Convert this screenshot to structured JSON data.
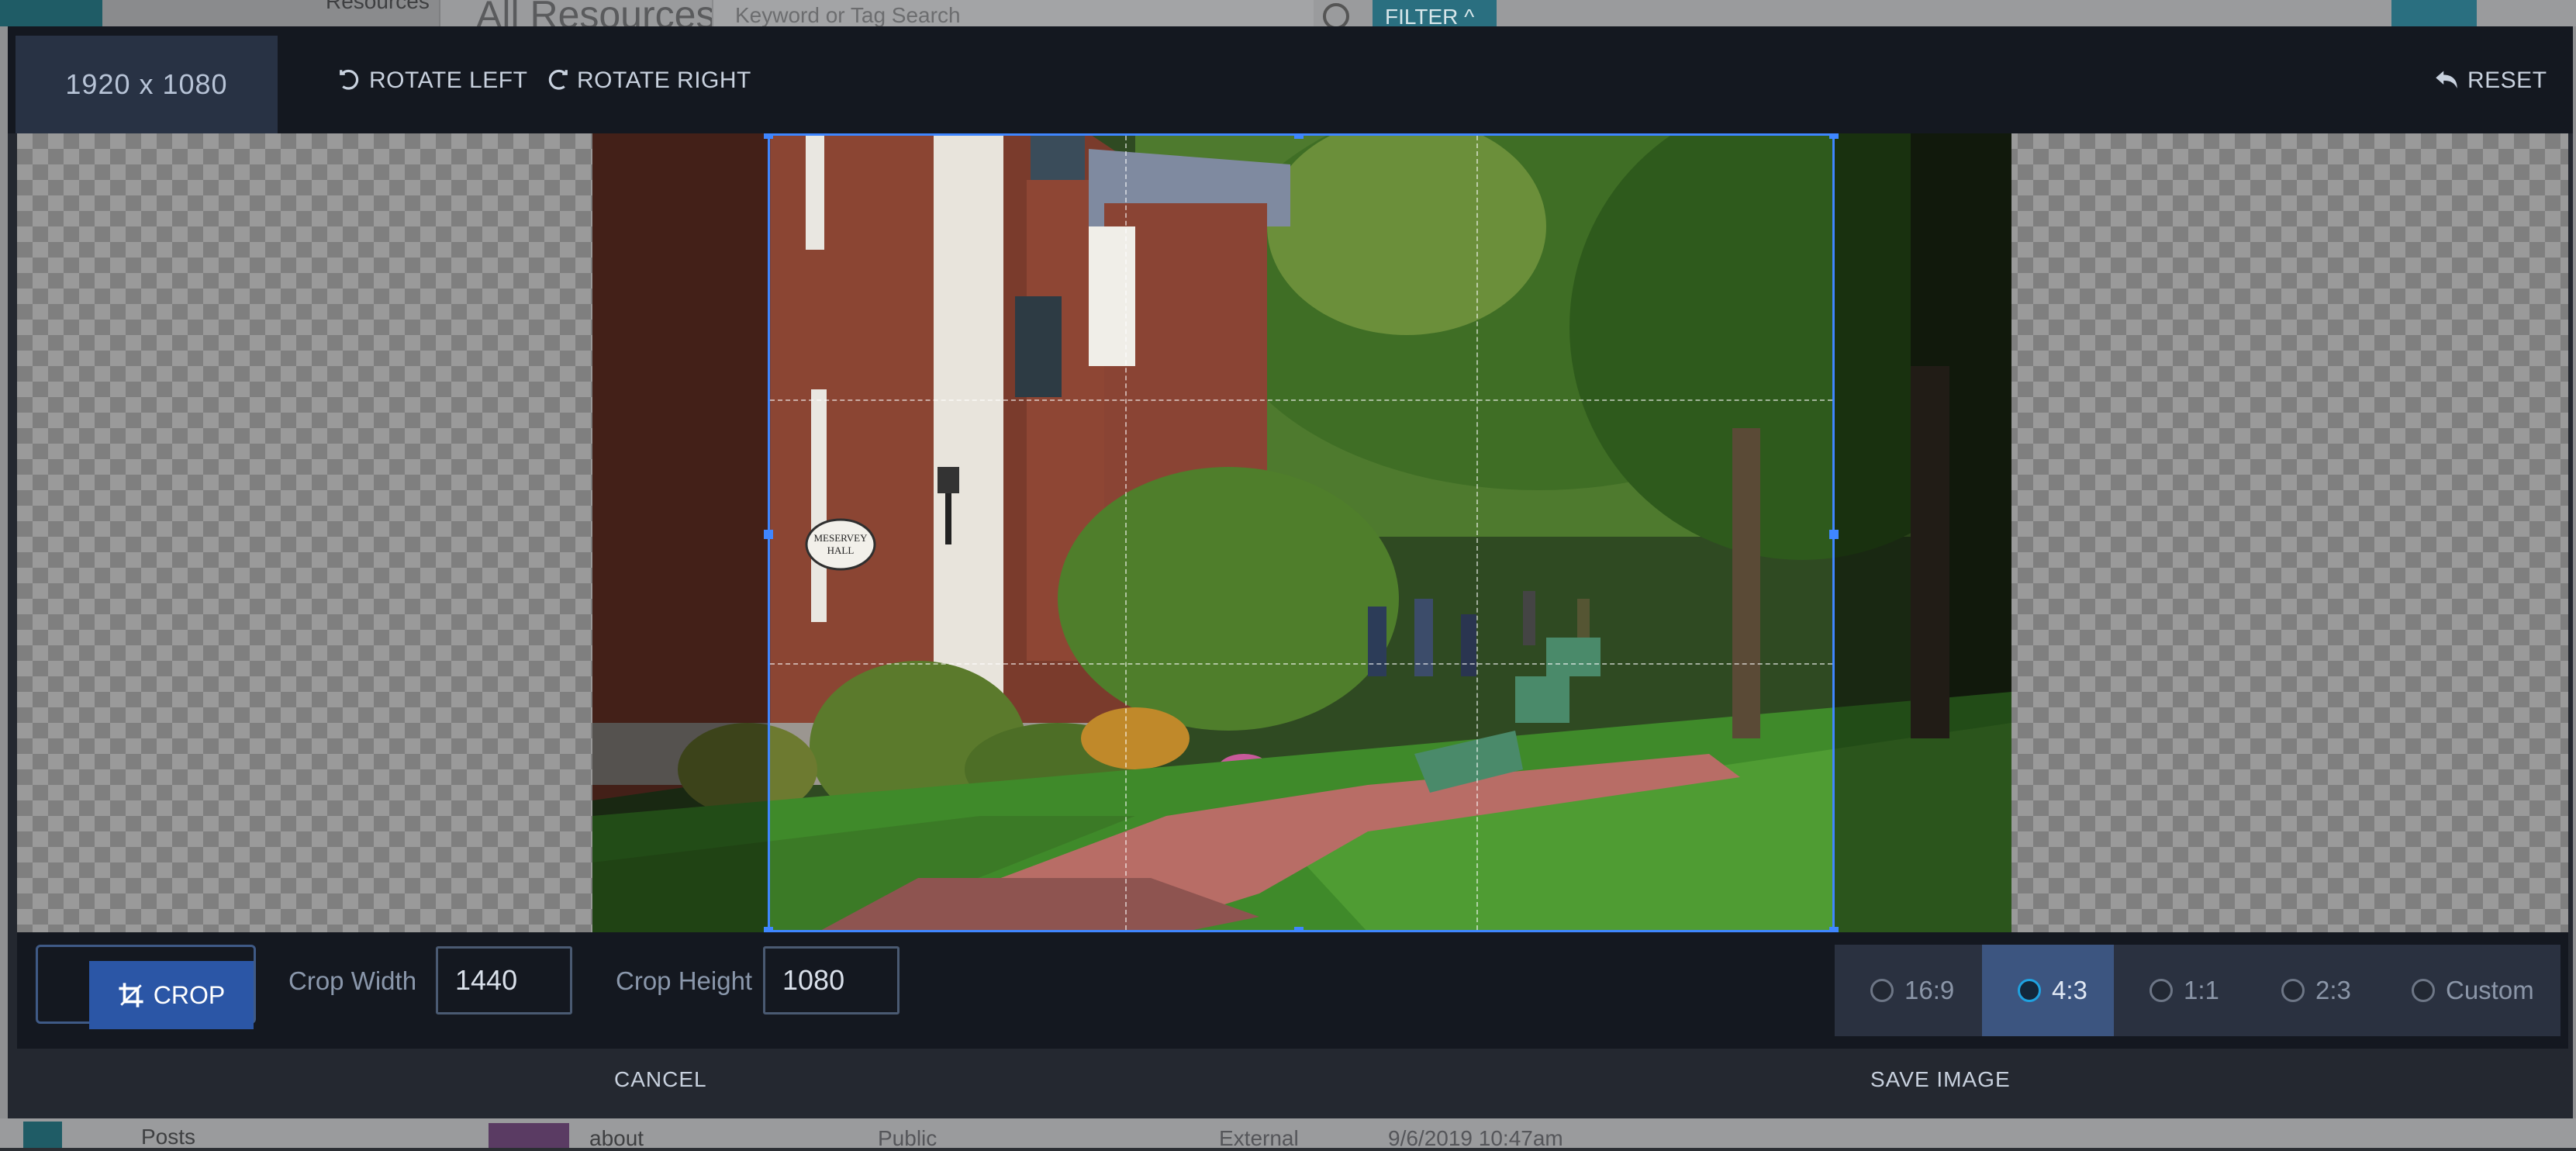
{
  "background": {
    "breadcrumb": "Resources",
    "page_title": "All Resources",
    "search_placeholder": "Keyword or Tag Search",
    "filter_label": "FILTER",
    "sidebar_item": "Posts",
    "row": {
      "name": "about",
      "visibility": "Public",
      "type": "External",
      "date": "9/6/2019 10:47am"
    }
  },
  "editor": {
    "dimensions": "1920 x 1080",
    "rotate_left": "ROTATE LEFT",
    "rotate_right": "ROTATE RIGHT",
    "reset": "RESET",
    "image": {
      "sign_line1": "MESERVEY",
      "sign_line2": "HALL"
    },
    "crop_button": "CROP",
    "crop_width_label": "Crop Width",
    "crop_width": "1440",
    "crop_height_label": "Crop Height",
    "crop_height": "1080",
    "ratios": [
      {
        "label": "16:9",
        "selected": false
      },
      {
        "label": "4:3",
        "selected": true
      },
      {
        "label": "1:1",
        "selected": false
      },
      {
        "label": "2:3",
        "selected": false
      },
      {
        "label": "Custom",
        "selected": false
      }
    ],
    "cancel": "CANCEL",
    "save": "SAVE IMAGE"
  },
  "colors": {
    "accent": "#3f86ff",
    "crop_button": "#2b56a6",
    "active_ratio": "#3c5580",
    "header_bg": "#141820"
  }
}
